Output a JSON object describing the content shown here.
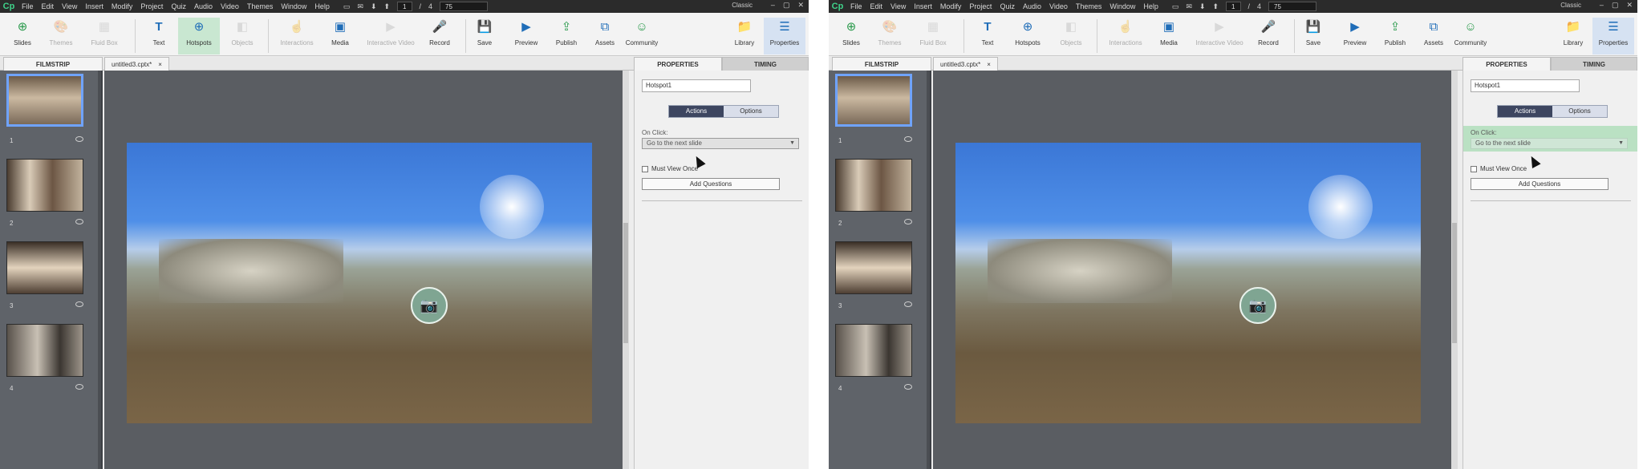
{
  "app": {
    "logo": "Cp"
  },
  "menu": [
    "File",
    "Edit",
    "View",
    "Insert",
    "Modify",
    "Project",
    "Quiz",
    "Audio",
    "Video",
    "Themes",
    "Window",
    "Help"
  ],
  "menu_tools": {
    "page_current": "1",
    "page_sep": "/",
    "page_total": "4",
    "zoom": "75",
    "workspace": "Classic"
  },
  "toolbar": {
    "slides": "Slides",
    "themes": "Themes",
    "fluid_box": "Fluid Box",
    "text": "Text",
    "hotspots": "Hotspots",
    "objects": "Objects",
    "interactions": "Interactions",
    "media": "Media",
    "interactive_video": "Interactive Video",
    "record": "Record",
    "save": "Save",
    "preview": "Preview",
    "publish": "Publish",
    "assets": "Assets",
    "community": "Community",
    "library": "Library",
    "properties": "Properties"
  },
  "tabs": {
    "filmstrip": "FILMSTRIP",
    "file": "untitled3.cptx*",
    "file_close": "×",
    "properties": "PROPERTIES",
    "timing": "TIMING"
  },
  "filmstrip": {
    "numbers": [
      "1",
      "2",
      "3",
      "4"
    ]
  },
  "properties": {
    "name": "Hotspot1",
    "tab_actions": "Actions",
    "tab_options": "Options",
    "on_click_label": "On Click:",
    "action": "Go to the next slide",
    "must_view": "Must View Once",
    "add_questions": "Add Questions"
  },
  "colors": {
    "accent_active": "#c9e7d1",
    "highlight": "#77ce8c",
    "stage": "#5a5d62",
    "segment_on": "#3d4660"
  }
}
